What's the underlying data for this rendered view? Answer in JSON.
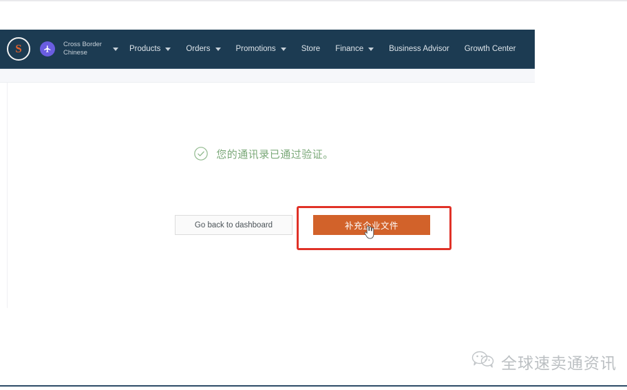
{
  "navbar": {
    "logo_letter": "S",
    "plane_icon": "airplane-icon",
    "account_switcher": {
      "line1": "Cross Border",
      "line2": "Chinese"
    },
    "items": [
      {
        "label": "Products",
        "has_dropdown": true
      },
      {
        "label": "Orders",
        "has_dropdown": true
      },
      {
        "label": "Promotions",
        "has_dropdown": true
      },
      {
        "label": "Store",
        "has_dropdown": false
      },
      {
        "label": "Finance",
        "has_dropdown": true
      },
      {
        "label": "Business Advisor",
        "has_dropdown": false
      },
      {
        "label": "Growth Center",
        "has_dropdown": false
      }
    ]
  },
  "main": {
    "success_message": "您的通讯录已通过验证。",
    "success_icon": "circle-check-icon",
    "buttons": {
      "secondary_label": "Go back to dashboard",
      "primary_label": "补充企业文件"
    },
    "cursor": "pointing-hand-cursor",
    "annotation": "red-highlight-box"
  },
  "watermark": {
    "icon": "wechat-icon",
    "text": "全球速卖通资讯"
  },
  "colors": {
    "navbar_bg": "#1c3b52",
    "primary_button": "#d2622a",
    "annotation_red": "#e03127",
    "success_green": "#7aa878",
    "brand_orange": "#e2622c",
    "plane_badge": "#6a5de0"
  }
}
